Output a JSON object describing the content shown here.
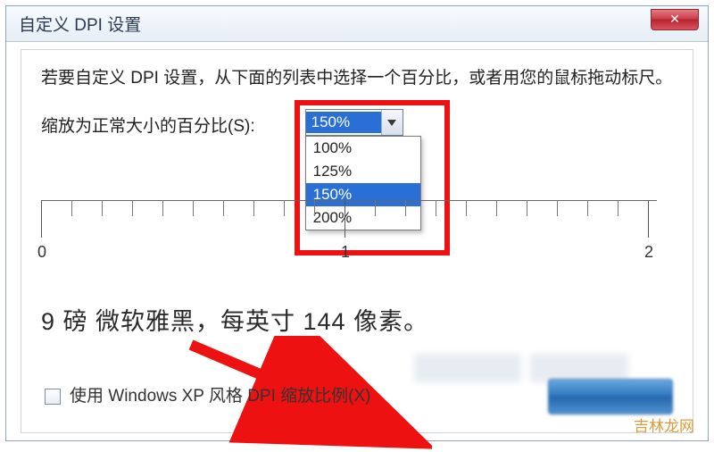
{
  "title": "自定义 DPI 设置",
  "close_glyph": "✕",
  "instructions": "若要自定义 DPI 设置，从下面的列表中选择一个百分比，或者用您的鼠标拖动标尺。",
  "scale_label": "缩放为正常大小的百分比(S):",
  "combo_value": "150%",
  "options": [
    "100%",
    "125%",
    "150%",
    "200%"
  ],
  "selected_index": 2,
  "ruler_ticks": [
    "0",
    "1",
    "2"
  ],
  "sample": "9 磅 微软雅黑，每英寸 144 像素。",
  "checkbox_label": "使用 Windows XP 风格 DPI 缩放比例(X)",
  "watermark": "吉林龙网"
}
